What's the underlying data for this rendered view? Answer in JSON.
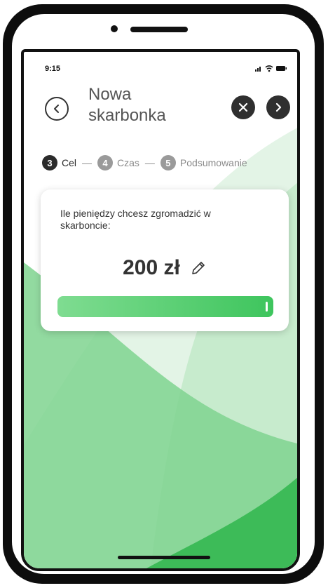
{
  "status_bar": {
    "time": "9:15"
  },
  "header": {
    "title": "Nowa skarbonka"
  },
  "steps": [
    {
      "number": "3",
      "label": "Cel",
      "state": "active"
    },
    {
      "number": "4",
      "label": "Czas",
      "state": "inactive"
    },
    {
      "number": "5",
      "label": "Podsumowanie",
      "state": "inactive"
    }
  ],
  "step_separator": "—",
  "card": {
    "question": "Ile pieniędzy chcesz zgromadzić w skarboncie:",
    "amount": "200 zł",
    "slider_level_percent": 100
  },
  "icons": {
    "back": "chevron-left-icon",
    "close": "close-icon",
    "next": "chevron-right-icon",
    "edit": "pencil-icon"
  },
  "colors": {
    "accent_green": "#3ec55d",
    "dark_button": "#2f2f2f"
  }
}
